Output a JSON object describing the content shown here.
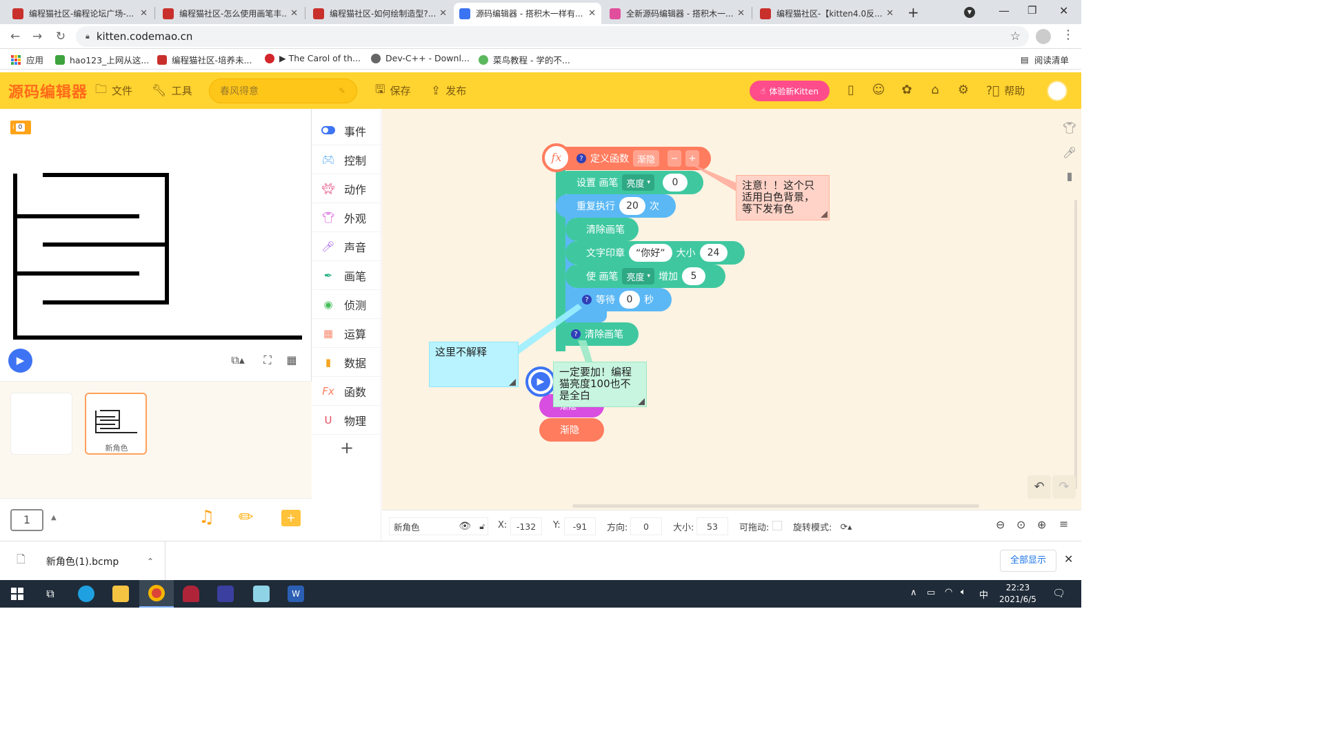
{
  "browser": {
    "tabs": [
      {
        "title": "编程猫社区-编程论坛广场-...",
        "color": "#c9302c"
      },
      {
        "title": "编程猫社区-怎么使用画笔丰...",
        "color": "#c9302c"
      },
      {
        "title": "编程猫社区-如何绘制造型?...",
        "color": "#c9302c"
      },
      {
        "title": "源码编辑器 - 搭积木一样有...",
        "color": "#3a74f2"
      },
      {
        "title": "全新源码编辑器 - 搭积木一...",
        "color": "#e14f9c"
      },
      {
        "title": "编程猫社区-【kitten4.0反...",
        "color": "#c9302c"
      }
    ],
    "active_tab": 3,
    "new_tab": "+",
    "url": "kitten.codemao.cn",
    "bookmarks": [
      "应用",
      "hao123_上网从这...",
      "编程猫社区-培养未...",
      "▶ The Carol of th...",
      "Dev-C++ - Downl...",
      "菜鸟教程 - 学的不..."
    ],
    "reading_list": "阅读清单"
  },
  "editor": {
    "logo": "源码编辑器",
    "menu": {
      "file": "文件",
      "tools": "工具",
      "save": "保存",
      "publish": "发布",
      "help": "帮助"
    },
    "project_name": "春风得意",
    "new_kitten": "体验新Kitten",
    "variable_value": "0",
    "sprite_name": "新角色",
    "page_number": "1",
    "categories": [
      "事件",
      "控制",
      "动作",
      "外观",
      "声音",
      "画笔",
      "侦测",
      "运算",
      "数据",
      "函数",
      "物理"
    ],
    "category_colors": [
      "#3e74f4",
      "#4fa6f7",
      "#e5437c",
      "#d84ee0",
      "#a45ee6",
      "#2cb389",
      "#48bd5a",
      "#f78b71",
      "#f5a623",
      "#ff7c5e",
      "#e84a5f"
    ],
    "add_category": "+"
  },
  "blocks": {
    "define": {
      "label": "定义函数",
      "name": "渐隐",
      "minus": "−",
      "plus": "+",
      "fx": "fx"
    },
    "set_pen": {
      "label": "设置 画笔",
      "dropdown": "亮度",
      "value": "0"
    },
    "repeat": {
      "label": "重复执行",
      "value": "20",
      "unit": "次"
    },
    "clear1": "清除画笔",
    "stamp": {
      "label": "文字印章",
      "text": "“你好”",
      "size_label": "大小",
      "size": "24"
    },
    "change_pen": {
      "label": "使 画笔",
      "dropdown": "亮度",
      "inc_label": "增加",
      "value": "5"
    },
    "wait": {
      "label": "等待",
      "value": "0",
      "unit": "秒"
    },
    "clear2": "清除画笔",
    "hidden_block": "渐隐",
    "call": "渐隐"
  },
  "notes": {
    "note1": "注意！！这个只适用白色背景，等下发有色",
    "note2": "这里不解释",
    "note3": "一定要加！编程猫亮度100也不是全白"
  },
  "info": {
    "sprite": "新角色",
    "x_label": "X:",
    "x": "-132",
    "y_label": "Y:",
    "y": "-91",
    "dir_label": "方向:",
    "dir": "0",
    "size_label": "大小:",
    "size": "53",
    "drag_label": "可拖动:",
    "rotate_label": "旋转模式:"
  },
  "download": {
    "file": "新角色(1).bcmp",
    "show_all": "全部显示"
  },
  "taskbar": {
    "time": "22:23",
    "date": "2021/6/5",
    "ime": "中"
  }
}
